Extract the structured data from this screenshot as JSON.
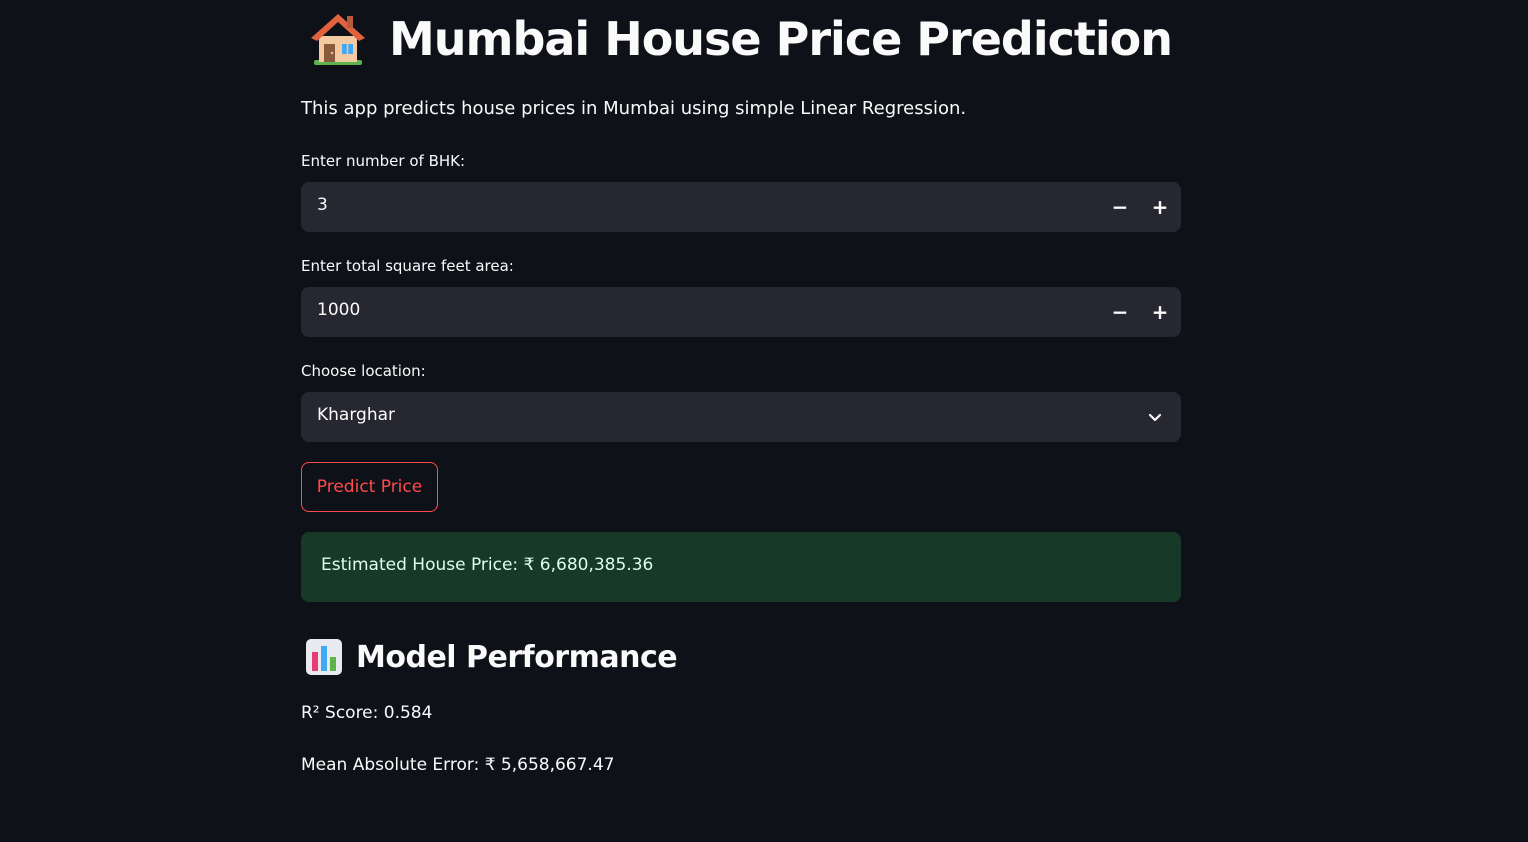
{
  "header": {
    "title": "Mumbai House Price Prediction",
    "title_icon": "house-icon"
  },
  "intro_text": "This app predicts house prices in Mumbai using simple Linear Regression.",
  "form": {
    "bhk": {
      "label": "Enter number of BHK:",
      "value": "3",
      "decrement_label": "−",
      "increment_label": "+"
    },
    "sqft": {
      "label": "Enter total square feet area:",
      "value": "1000",
      "decrement_label": "−",
      "increment_label": "+"
    },
    "location": {
      "label": "Choose location:",
      "selected": "Kharghar"
    },
    "predict_button": "Predict Price"
  },
  "result": {
    "text": "Estimated House Price: ₹ 6,680,385.36"
  },
  "performance": {
    "heading": "Model Performance",
    "heading_icon": "bar-chart-icon",
    "r2_text": "R² Score: 0.584",
    "mae_text": "Mean Absolute Error: ₹ 5,658,667.47"
  },
  "colors": {
    "background": "#0e1117",
    "input_bg": "#262730",
    "accent": "#ff4b4b",
    "success_bg": "#173928",
    "success_text": "#dffde9"
  }
}
